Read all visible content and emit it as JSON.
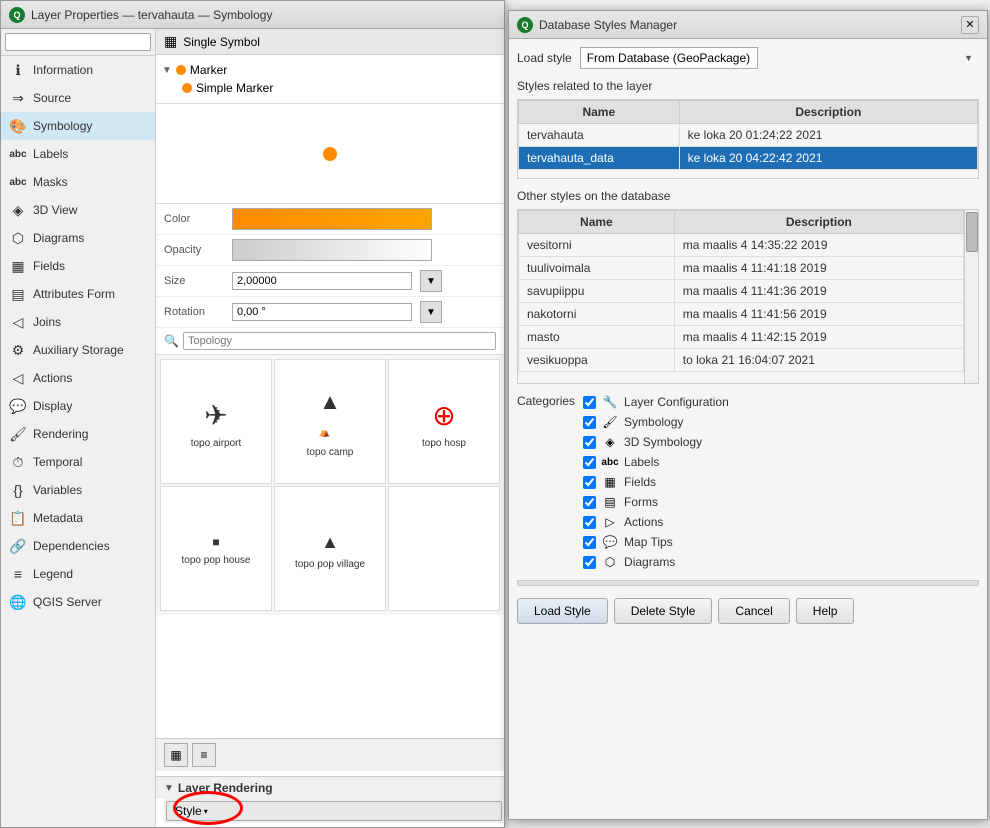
{
  "main_window": {
    "title": "Layer Properties — tervahauta — Symbology",
    "icon": "Q"
  },
  "sidebar": {
    "search_placeholder": "",
    "items": [
      {
        "id": "information",
        "label": "Information",
        "icon": "ℹ"
      },
      {
        "id": "source",
        "label": "Source",
        "icon": "⇒"
      },
      {
        "id": "symbology",
        "label": "Symbology",
        "icon": "🎨",
        "active": true
      },
      {
        "id": "labels",
        "label": "Labels",
        "icon": "abc"
      },
      {
        "id": "masks",
        "label": "Masks",
        "icon": "⬤"
      },
      {
        "id": "3dview",
        "label": "3D View",
        "icon": "◈"
      },
      {
        "id": "diagrams",
        "label": "Diagrams",
        "icon": "⬡"
      },
      {
        "id": "fields",
        "label": "Fields",
        "icon": "▦"
      },
      {
        "id": "attributes_form",
        "label": "Attributes Form",
        "icon": "▤"
      },
      {
        "id": "joins",
        "label": "Joins",
        "icon": "◁"
      },
      {
        "id": "auxiliary_storage",
        "label": "Auxiliary Storage",
        "icon": "⚙"
      },
      {
        "id": "actions",
        "label": "Actions",
        "icon": "◁"
      },
      {
        "id": "display",
        "label": "Display",
        "icon": "💬"
      },
      {
        "id": "rendering",
        "label": "Rendering",
        "icon": "🖌"
      },
      {
        "id": "temporal",
        "label": "Temporal",
        "icon": "⏱"
      },
      {
        "id": "variables",
        "label": "Variables",
        "icon": "{}"
      },
      {
        "id": "metadata",
        "label": "Metadata",
        "icon": "📋"
      },
      {
        "id": "dependencies",
        "label": "Dependencies",
        "icon": "🔗"
      },
      {
        "id": "legend",
        "label": "Legend",
        "icon": "≡"
      },
      {
        "id": "qgis_server",
        "label": "QGIS Server",
        "icon": "🌐"
      }
    ]
  },
  "symbology": {
    "header": "Single Symbol",
    "tree": {
      "marker_label": "Marker",
      "simple_marker_label": "Simple Marker"
    },
    "color_label": "Color",
    "opacity_label": "Opacity",
    "size_label": "Size",
    "size_value": "2,00000",
    "rotation_label": "Rotation",
    "rotation_value": "0,00 °",
    "filter_placeholder": "Topology",
    "symbols": [
      {
        "icon": "airplane",
        "label": "topo airport"
      },
      {
        "icon": "tent",
        "label": "topo camp"
      },
      {
        "icon": "plus_circle",
        "label": "topo hosp"
      },
      {
        "icon": "dot",
        "label": "topo pop house"
      },
      {
        "icon": "triangle",
        "label": "topo pop village"
      },
      {
        "icon": "",
        "label": ""
      }
    ]
  },
  "layer_rendering": {
    "label": "Layer Rendering",
    "style_btn": "Style",
    "style_arrow": "▾"
  },
  "dsm_window": {
    "title": "Database Styles Manager",
    "icon": "Q",
    "load_style_label": "Load style",
    "load_style_option": "From Database (GeoPackage)",
    "styles_related_label": "Styles related to the layer",
    "styles_related_cols": [
      "Name",
      "Description"
    ],
    "styles_related_rows": [
      {
        "name": "tervahauta",
        "desc": "ke loka 20 01:24:22 2021",
        "selected": false
      },
      {
        "name": "tervahauta_data",
        "desc": "ke loka 20 04:22:42 2021",
        "selected": true
      }
    ],
    "other_styles_label": "Other styles on the database",
    "other_styles_cols": [
      "Name",
      "Description"
    ],
    "other_styles_rows": [
      {
        "name": "vesitorni",
        "desc": "ma maalis 4 14:35:22 2019"
      },
      {
        "name": "tuulivoimala",
        "desc": "ma maalis 4 11:41:18 2019"
      },
      {
        "name": "savupiippu",
        "desc": "ma maalis 4 11:41:36 2019"
      },
      {
        "name": "nakotorni",
        "desc": "ma maalis 4 11:41:56 2019"
      },
      {
        "name": "masto",
        "desc": "ma maalis 4 11:42:15 2019"
      },
      {
        "name": "vesikuoppa",
        "desc": "to loka 21 16:04:07 2021"
      }
    ],
    "categories_label": "Categories",
    "categories": [
      {
        "id": "layer_config",
        "label": "Layer Configuration",
        "checked": true
      },
      {
        "id": "symbology",
        "label": "Symbology",
        "checked": true
      },
      {
        "id": "symbology_3d",
        "label": "3D Symbology",
        "checked": true
      },
      {
        "id": "labels",
        "label": "Labels",
        "checked": true
      },
      {
        "id": "fields",
        "label": "Fields",
        "checked": true
      },
      {
        "id": "forms",
        "label": "Forms",
        "checked": true
      },
      {
        "id": "actions",
        "label": "Actions",
        "checked": true
      },
      {
        "id": "map_tips",
        "label": "Map Tips",
        "checked": true
      },
      {
        "id": "diagrams",
        "label": "Diagrams",
        "checked": true
      }
    ],
    "btn_load_style": "Load Style",
    "btn_delete_style": "Delete Style",
    "btn_cancel": "Cancel",
    "btn_help": "Help"
  }
}
